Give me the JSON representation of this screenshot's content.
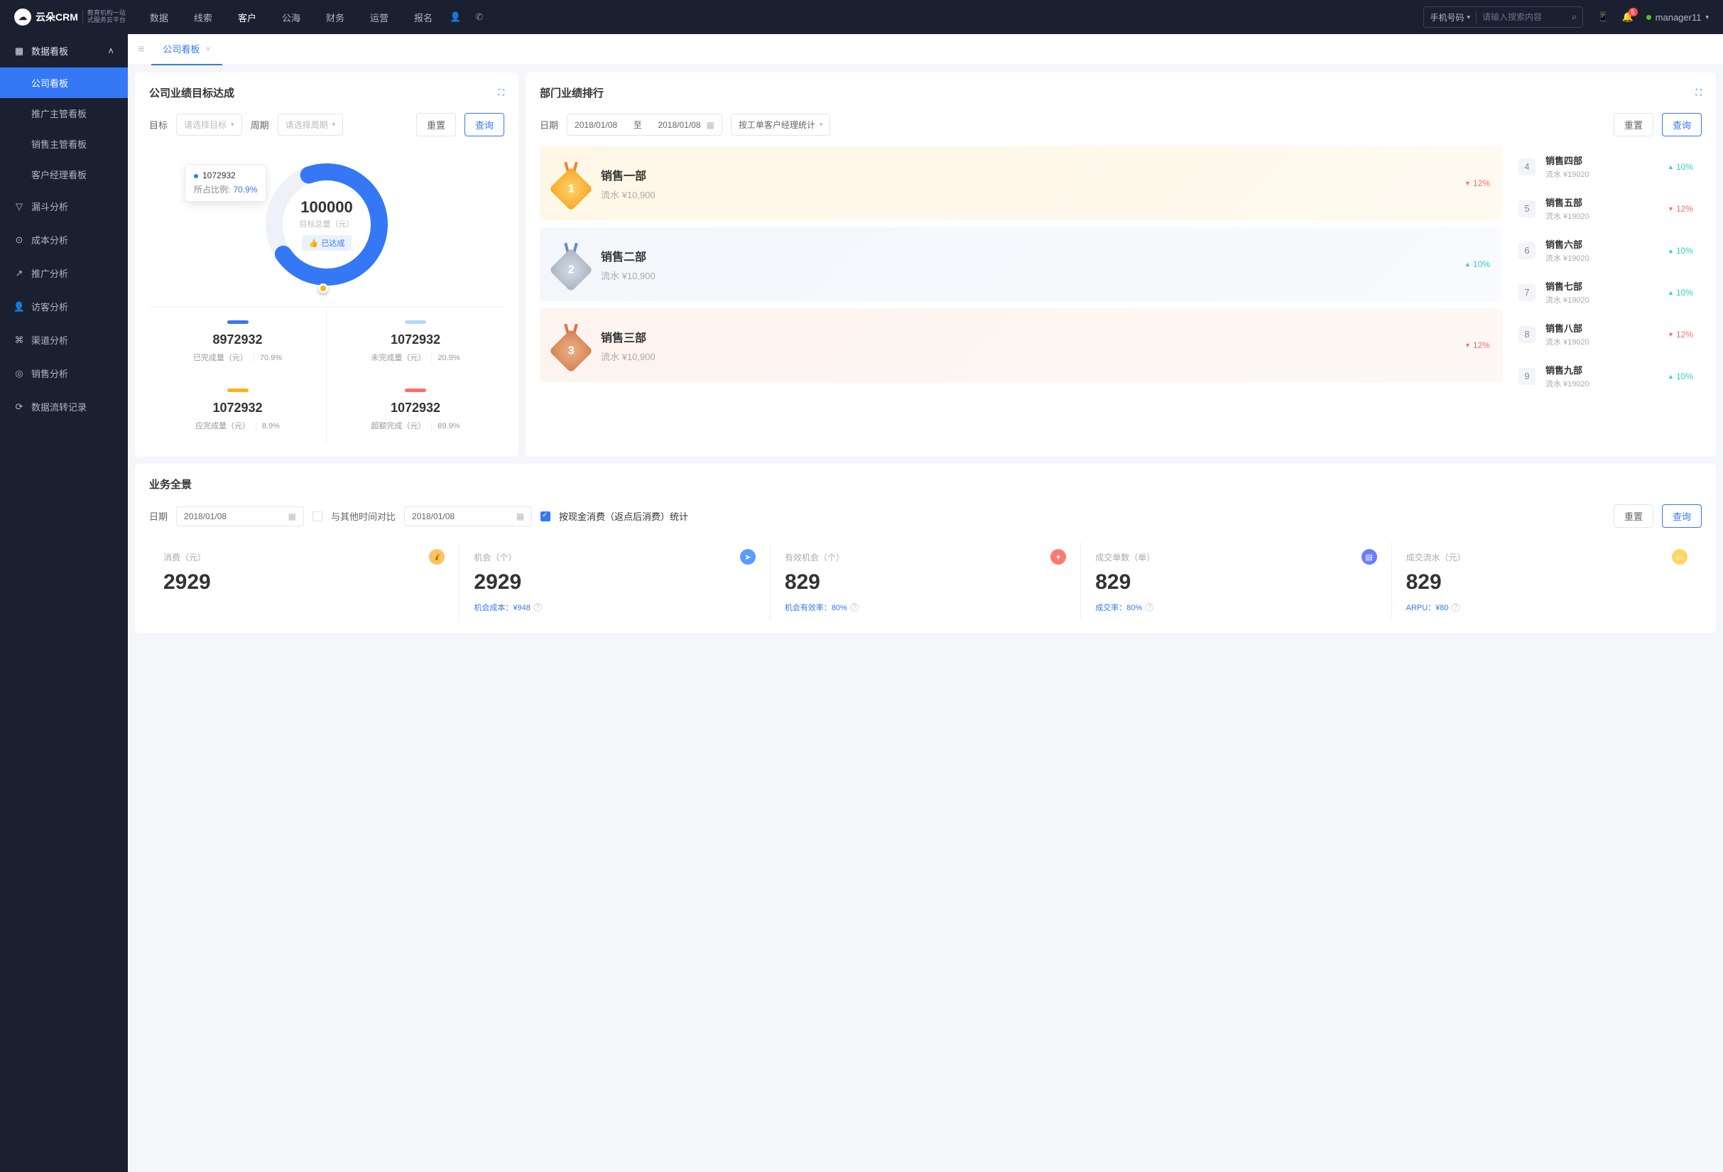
{
  "topnav": {
    "logo_main": "云朵CRM",
    "logo_sub1": "教育机构一站",
    "logo_sub2": "式服务云平台",
    "items": [
      "数据",
      "线索",
      "客户",
      "公海",
      "财务",
      "运营",
      "报名"
    ],
    "active_index": 2,
    "search_type": "手机号码",
    "search_placeholder": "请输入搜索内容",
    "badge": "5",
    "username": "manager11"
  },
  "sidebar": {
    "group": "数据看板",
    "subs": [
      "公司看板",
      "推广主管看板",
      "销售主管看板",
      "客户经理看板"
    ],
    "active_sub": 0,
    "simple": [
      "漏斗分析",
      "成本分析",
      "推广分析",
      "访客分析",
      "渠道分析",
      "销售分析",
      "数据流转记录"
    ]
  },
  "tab_title": "公司看板",
  "goal": {
    "title": "公司业绩目标达成",
    "label_target": "目标",
    "target_placeholder": "请选择目标",
    "label_period": "周期",
    "period_placeholder": "请选择周期",
    "btn_reset": "重置",
    "btn_query": "查询",
    "center_value": "100000",
    "center_label": "目标总量（元）",
    "tag": "已达成",
    "tooltip_val": "1072932",
    "tooltip_label": "所占比例:",
    "tooltip_pct": "70.9%",
    "stats": [
      {
        "bar": "#3478f6",
        "num": "8972932",
        "lbl": "已完成量（元）",
        "pct": "70.9%"
      },
      {
        "bar": "#b8d4ff",
        "num": "1072932",
        "lbl": "未完成量（元）",
        "pct": "20.9%"
      },
      {
        "bar": "#ffb020",
        "num": "1072932",
        "lbl": "应完成量（元）",
        "pct": "8.9%"
      },
      {
        "bar": "#ff6b6b",
        "num": "1072932",
        "lbl": "超额完成（元）",
        "pct": "89.9%"
      }
    ]
  },
  "rank": {
    "title": "部门业绩排行",
    "label_date": "日期",
    "date_from": "2018/01/08",
    "date_sep": "至",
    "date_to": "2018/01/08",
    "select_label": "按工单客户经理统计",
    "btn_reset": "重置",
    "btn_query": "查询",
    "top3": [
      {
        "rank": "1",
        "name": "销售一部",
        "sub": "流水 ¥10,900",
        "dir": "down",
        "pct": "12%",
        "cls": "rc-gold",
        "mcls": "m-gold"
      },
      {
        "rank": "2",
        "name": "销售二部",
        "sub": "流水 ¥10,900",
        "dir": "up",
        "pct": "10%",
        "cls": "rc-silver",
        "mcls": "m-silver"
      },
      {
        "rank": "3",
        "name": "销售三部",
        "sub": "流水 ¥10,900",
        "dir": "down",
        "pct": "12%",
        "cls": "rc-bronze",
        "mcls": "m-bronze"
      }
    ],
    "others": [
      {
        "n": "4",
        "name": "销售四部",
        "sub": "流水 ¥19020",
        "dir": "up",
        "pct": "10%"
      },
      {
        "n": "5",
        "name": "销售五部",
        "sub": "流水 ¥19020",
        "dir": "down",
        "pct": "12%"
      },
      {
        "n": "6",
        "name": "销售六部",
        "sub": "流水 ¥19020",
        "dir": "up",
        "pct": "10%"
      },
      {
        "n": "7",
        "name": "销售七部",
        "sub": "流水 ¥19020",
        "dir": "up",
        "pct": "10%"
      },
      {
        "n": "8",
        "name": "销售八部",
        "sub": "流水 ¥19020",
        "dir": "down",
        "pct": "12%"
      },
      {
        "n": "9",
        "name": "销售九部",
        "sub": "流水 ¥19020",
        "dir": "up",
        "pct": "10%"
      }
    ]
  },
  "overview": {
    "title": "业务全景",
    "label_date": "日期",
    "date1": "2018/01/08",
    "compare_label": "与其他时间对比",
    "date2": "2018/01/08",
    "checkbox_label": "按现金消费（返点后消费）统计",
    "btn_reset": "重置",
    "btn_query": "查询",
    "metrics": [
      {
        "lbl": "消费（元）",
        "val": "2929",
        "icon": "mi-orange",
        "glyph": "💰",
        "foot": ""
      },
      {
        "lbl": "机会（个）",
        "val": "2929",
        "icon": "mi-blue",
        "glyph": "➤",
        "foot": "机会成本：¥948"
      },
      {
        "lbl": "有效机会（个）",
        "val": "829",
        "icon": "mi-red",
        "glyph": "✦",
        "foot": "机会有效率：80%"
      },
      {
        "lbl": "成交单数（单）",
        "val": "829",
        "icon": "mi-purple",
        "glyph": "▤",
        "foot": "成交率：80%"
      },
      {
        "lbl": "成交流水（元）",
        "val": "829",
        "icon": "mi-yellow",
        "glyph": "▭",
        "foot": "ARPU：¥80"
      }
    ]
  },
  "chart_data": {
    "type": "pie",
    "title": "公司业绩目标达成",
    "total": 100000,
    "total_label": "目标总量（元）",
    "series": [
      {
        "name": "已完成量（元）",
        "value": 8972932,
        "pct": 70.9,
        "color": "#3478f6"
      },
      {
        "name": "未完成量（元）",
        "value": 1072932,
        "pct": 20.9,
        "color": "#b8d4ff"
      },
      {
        "name": "应完成量（元）",
        "value": 1072932,
        "pct": 8.9,
        "color": "#ffb020"
      },
      {
        "name": "超额完成（元）",
        "value": 1072932,
        "pct": 89.9,
        "color": "#ff6b6b"
      }
    ],
    "highlighted": {
      "value": 1072932,
      "pct": 70.9
    }
  }
}
